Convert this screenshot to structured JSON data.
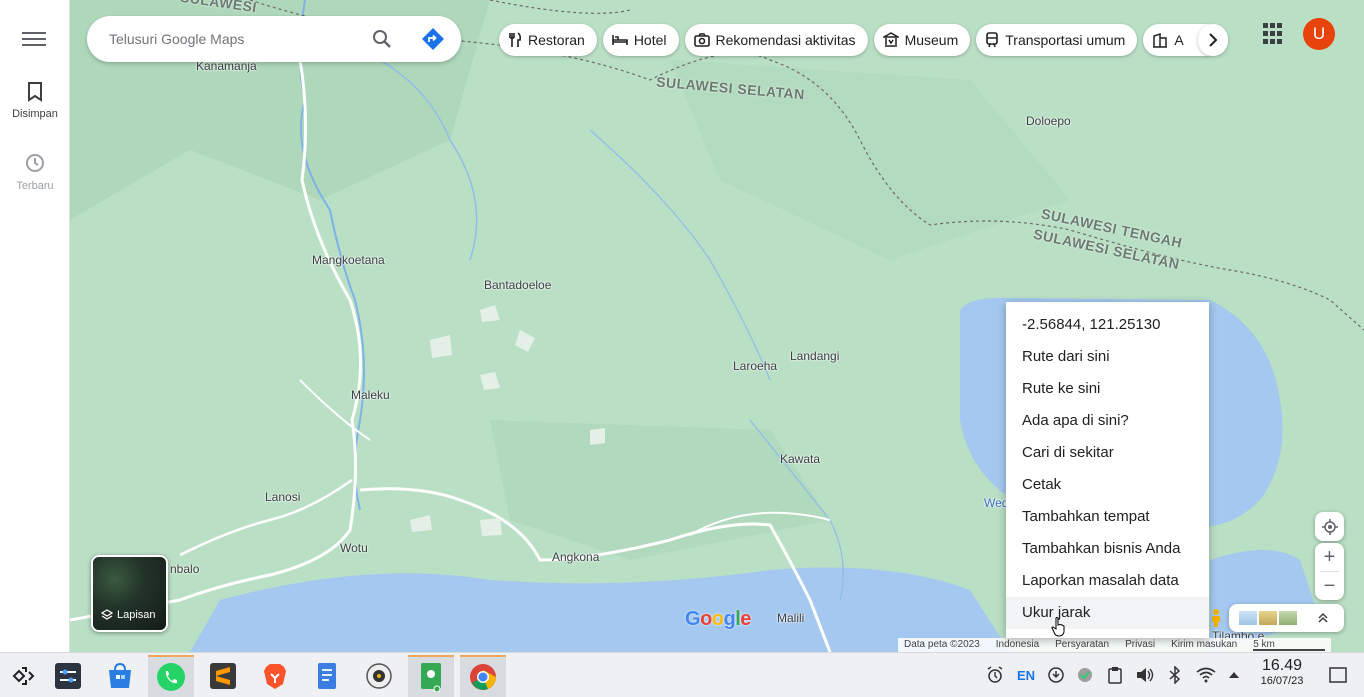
{
  "sidebar": {
    "saved_label": "Disimpan",
    "recent_label": "Terbaru"
  },
  "search": {
    "placeholder": "Telusuri Google Maps"
  },
  "chips": [
    {
      "label": "Restoran",
      "icon": "fork-knife-icon"
    },
    {
      "label": "Hotel",
      "icon": "bed-icon"
    },
    {
      "label": "Rekomendasi aktivitas",
      "icon": "camera-icon"
    },
    {
      "label": "Museum",
      "icon": "museum-icon"
    },
    {
      "label": "Transportasi umum",
      "icon": "train-icon"
    },
    {
      "label": "A",
      "icon": "building-icon"
    }
  ],
  "account": {
    "initial": "U",
    "color": "#e8430a"
  },
  "map": {
    "places": [
      "Kanamanja",
      "Mangkoetana",
      "Bantadoeloe",
      "Laroeha",
      "Landangi",
      "Maleku",
      "Kawata",
      "Lanosi",
      "Wotu",
      "Angkona",
      "Malili",
      "Doloepo",
      "nbalo",
      "Wed",
      "Tilambo e"
    ],
    "regions": [
      "SULAWESI SELATAN",
      "SULAWESI TENGAH",
      "SULAWESI SELATAN",
      "SULAWESI"
    ],
    "layers_label": "Lapisan",
    "logo": "Google"
  },
  "context_menu": {
    "items": [
      "-2.56844, 121.25130",
      "Rute dari sini",
      "Rute ke sini",
      "Ada apa di sini?",
      "Cari di sekitar",
      "Cetak",
      "Tambahkan tempat",
      "Tambahkan bisnis Anda",
      "Laporkan masalah data",
      "Ukur jarak"
    ],
    "highlighted_index": 9
  },
  "footer": {
    "items": [
      "Data peta ©2023",
      "Indonesia",
      "Persyaratan",
      "Privasi",
      "Kirim masukan",
      "5 km"
    ]
  },
  "taskbar": {
    "language": "EN",
    "time": "16.49",
    "date": "16/07/23"
  }
}
